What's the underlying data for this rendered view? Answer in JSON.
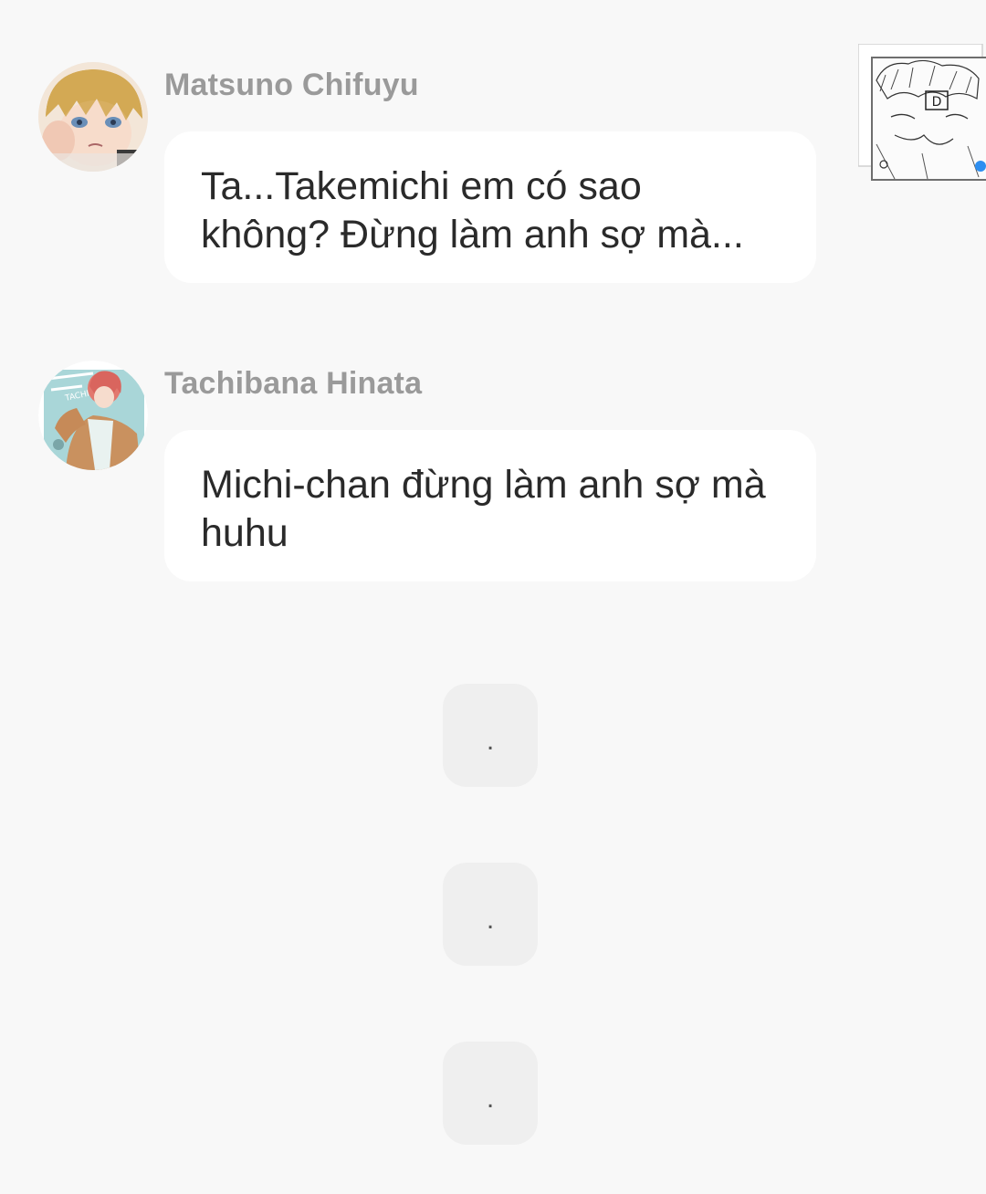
{
  "messages": [
    {
      "sender": "Matsuno Chifuyu",
      "avatar_icon": "chifuyu-avatar-icon",
      "text": "Ta...Takemichi em có sao không? Đừng làm anh sợ mà..."
    },
    {
      "sender": "Tachibana Hinata",
      "avatar_icon": "hinata-avatar-icon",
      "text": "Michi-chan đừng làm anh sợ mà huhu"
    }
  ],
  "thumbnail": {
    "icon": "manga-thumbnail-image"
  },
  "separators": [
    ".",
    ".",
    "."
  ],
  "colors": {
    "background": "#f8f8f8",
    "bubble": "#ffffff",
    "sender_name": "#9a9a9a",
    "message_text": "#2a2a2a",
    "separator_box": "#efefef"
  }
}
